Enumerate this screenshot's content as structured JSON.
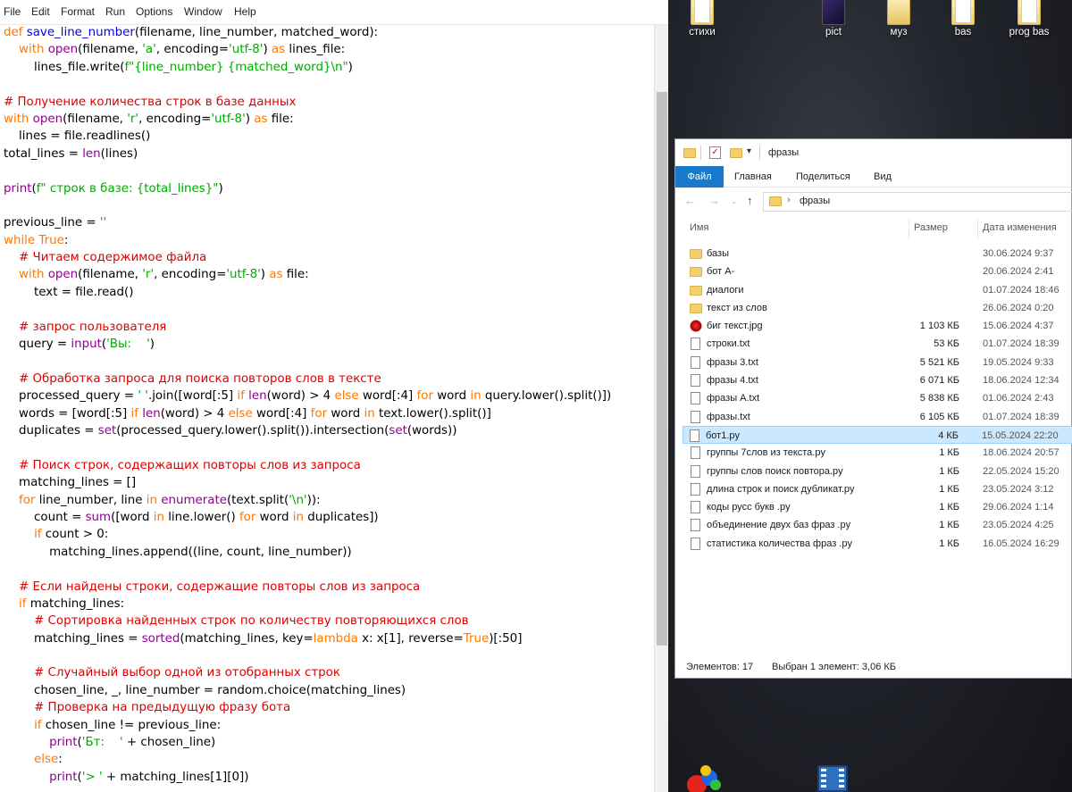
{
  "menubar": [
    "File",
    "Edit",
    "Format",
    "Run",
    "Options",
    "Window",
    "Help"
  ],
  "code_lines": [
    [
      [
        "def ",
        "kw"
      ],
      [
        "save_line_number",
        "fn"
      ],
      [
        "(filename, line_number, matched_word):",
        ""
      ]
    ],
    [
      [
        "    ",
        ""
      ],
      [
        "with ",
        "kw"
      ],
      [
        "open",
        "bi"
      ],
      [
        "(filename, ",
        ""
      ],
      [
        "'a'",
        "str"
      ],
      [
        ", encoding=",
        ""
      ],
      [
        "'utf-8'",
        "str"
      ],
      [
        ") ",
        ""
      ],
      [
        "as ",
        "kw"
      ],
      [
        "lines_file:",
        ""
      ]
    ],
    [
      [
        "        lines_file.write(",
        ""
      ],
      [
        "f\"{line_number} {matched_word}\\n\"",
        "str"
      ],
      [
        ")",
        ""
      ]
    ],
    [],
    [
      [
        "# Получение количества строк в базе данных",
        "cmt"
      ]
    ],
    [
      [
        "with ",
        "kw"
      ],
      [
        "open",
        "bi"
      ],
      [
        "(filename, ",
        ""
      ],
      [
        "'r'",
        "str"
      ],
      [
        ", encoding=",
        ""
      ],
      [
        "'utf-8'",
        "str"
      ],
      [
        ") ",
        ""
      ],
      [
        "as ",
        "kw"
      ],
      [
        "file:",
        ""
      ]
    ],
    [
      [
        "    lines = file.readlines()",
        ""
      ]
    ],
    [
      [
        "total_lines = ",
        ""
      ],
      [
        "len",
        "bi"
      ],
      [
        "(lines)",
        ""
      ]
    ],
    [],
    [
      [
        "print",
        "bi"
      ],
      [
        "(",
        ""
      ],
      [
        "f\" строк в базе: {total_lines}\"",
        "str"
      ],
      [
        ")",
        ""
      ]
    ],
    [],
    [
      [
        "previous_line = ",
        ""
      ],
      [
        "''",
        "str"
      ]
    ],
    [
      [
        "while ",
        "kw"
      ],
      [
        "True",
        "kw"
      ],
      [
        ":",
        ""
      ]
    ],
    [
      [
        "    ",
        ""
      ],
      [
        "# Читаем содержимое файла",
        "cmt"
      ]
    ],
    [
      [
        "    ",
        ""
      ],
      [
        "with ",
        "kw"
      ],
      [
        "open",
        "bi"
      ],
      [
        "(filename, ",
        ""
      ],
      [
        "'r'",
        "str"
      ],
      [
        ", encoding=",
        ""
      ],
      [
        "'utf-8'",
        "str"
      ],
      [
        ") ",
        ""
      ],
      [
        "as ",
        "kw"
      ],
      [
        "file:",
        ""
      ]
    ],
    [
      [
        "        text = file.read()",
        ""
      ]
    ],
    [],
    [
      [
        "    ",
        ""
      ],
      [
        "# запрос пользователя",
        "cmt"
      ]
    ],
    [
      [
        "    query = ",
        ""
      ],
      [
        "input",
        "bi"
      ],
      [
        "(",
        ""
      ],
      [
        "'Вы:    '",
        "str"
      ],
      [
        ")",
        ""
      ]
    ],
    [],
    [
      [
        "    ",
        ""
      ],
      [
        "# Обработка запроса для поиска повторов слов в тексте",
        "cmt"
      ]
    ],
    [
      [
        "    processed_query = ",
        ""
      ],
      [
        "' '",
        "str"
      ],
      [
        ".join([word[:5] ",
        ""
      ],
      [
        "if ",
        "kw"
      ],
      [
        "len",
        "bi"
      ],
      [
        "(word) > 4 ",
        ""
      ],
      [
        "else ",
        "kw"
      ],
      [
        "word[:4] ",
        ""
      ],
      [
        "for ",
        "kw"
      ],
      [
        "word ",
        ""
      ],
      [
        "in ",
        "kw"
      ],
      [
        "query.lower().split()])",
        ""
      ]
    ],
    [
      [
        "    words = [word[:5] ",
        ""
      ],
      [
        "if ",
        "kw"
      ],
      [
        "len",
        "bi"
      ],
      [
        "(word) > 4 ",
        ""
      ],
      [
        "else ",
        "kw"
      ],
      [
        "word[:4] ",
        ""
      ],
      [
        "for ",
        "kw"
      ],
      [
        "word ",
        ""
      ],
      [
        "in ",
        "kw"
      ],
      [
        "text.lower().split()]",
        ""
      ]
    ],
    [
      [
        "    duplicates = ",
        ""
      ],
      [
        "set",
        "bi"
      ],
      [
        "(processed_query.lower().split()).intersection(",
        ""
      ],
      [
        "set",
        "bi"
      ],
      [
        "(words))",
        ""
      ]
    ],
    [],
    [
      [
        "    ",
        ""
      ],
      [
        "# Поиск строк, содержащих повторы слов из запроса",
        "cmt"
      ]
    ],
    [
      [
        "    matching_lines = []",
        ""
      ]
    ],
    [
      [
        "    ",
        ""
      ],
      [
        "for ",
        "kw"
      ],
      [
        "line_number, line ",
        ""
      ],
      [
        "in ",
        "kw"
      ],
      [
        "enumerate",
        "bi"
      ],
      [
        "(text.split(",
        ""
      ],
      [
        "'\\n'",
        "str"
      ],
      [
        ")):",
        ""
      ]
    ],
    [
      [
        "        count = ",
        ""
      ],
      [
        "sum",
        "bi"
      ],
      [
        "([word ",
        ""
      ],
      [
        "in ",
        "kw"
      ],
      [
        "line.lower() ",
        ""
      ],
      [
        "for ",
        "kw"
      ],
      [
        "word ",
        ""
      ],
      [
        "in ",
        "kw"
      ],
      [
        "duplicates])",
        ""
      ]
    ],
    [
      [
        "        ",
        ""
      ],
      [
        "if ",
        "kw"
      ],
      [
        "count > 0:",
        ""
      ]
    ],
    [
      [
        "            matching_lines.append((line, count, line_number))",
        ""
      ]
    ],
    [],
    [
      [
        "    ",
        ""
      ],
      [
        "# Если найдены строки, содержащие повторы слов из запроса",
        "cmt"
      ]
    ],
    [
      [
        "    ",
        ""
      ],
      [
        "if ",
        "kw"
      ],
      [
        "matching_lines:",
        ""
      ]
    ],
    [
      [
        "        ",
        ""
      ],
      [
        "# Сортировка найденных строк по количеству повторяющихся слов",
        "cmt"
      ]
    ],
    [
      [
        "        matching_lines = ",
        ""
      ],
      [
        "sorted",
        "bi"
      ],
      [
        "(matching_lines, key=",
        ""
      ],
      [
        "lambda ",
        "kw"
      ],
      [
        "x: x[1], reverse=",
        ""
      ],
      [
        "True",
        "kw"
      ],
      [
        ")[:50]",
        ""
      ]
    ],
    [],
    [
      [
        "        ",
        ""
      ],
      [
        "# Случайный выбор одной из отобранных строк",
        "cmt"
      ]
    ],
    [
      [
        "        chosen_line, _, line_number = random.choice(matching_lines)",
        ""
      ]
    ],
    [
      [
        "        ",
        ""
      ],
      [
        "# Проверка на предыдущую фразу бота",
        "cmt"
      ]
    ],
    [
      [
        "        ",
        ""
      ],
      [
        "if ",
        "kw"
      ],
      [
        "chosen_line != previous_line:",
        ""
      ]
    ],
    [
      [
        "            ",
        ""
      ],
      [
        "print",
        "bi"
      ],
      [
        "(",
        ""
      ],
      [
        "'Бт:    '",
        "str"
      ],
      [
        " + chosen_line)",
        ""
      ]
    ],
    [
      [
        "        ",
        ""
      ],
      [
        "else",
        "kw"
      ],
      [
        ":",
        ""
      ]
    ],
    [
      [
        "            ",
        ""
      ],
      [
        "print",
        "bi"
      ],
      [
        "(",
        ""
      ],
      [
        "'> '",
        "str"
      ],
      [
        " + matching_lines[1][0])",
        ""
      ]
    ]
  ],
  "desktop_icons": [
    {
      "label": "стихи",
      "kind": "folder"
    },
    {
      "label": "pict",
      "kind": "thumb-dark"
    },
    {
      "label": "муз",
      "kind": "thumb-music"
    },
    {
      "label": "bas",
      "kind": "folder"
    },
    {
      "label": "prog bas",
      "kind": "folder"
    }
  ],
  "explorer": {
    "title": "фразы",
    "ribbon_tabs": [
      "Файл",
      "Главная",
      "Поделиться",
      "Вид"
    ],
    "address_path": "фразы",
    "columns": {
      "name": "Имя",
      "size": "Размер",
      "date": "Дата изменения"
    },
    "files": [
      {
        "name": "базы",
        "size": "",
        "date": "30.06.2024 9:37",
        "icon": "folder"
      },
      {
        "name": "бот А-",
        "size": "",
        "date": "20.06.2024 2:41",
        "icon": "folder"
      },
      {
        "name": "диалоги",
        "size": "",
        "date": "01.07.2024 18:46",
        "icon": "folder"
      },
      {
        "name": "текст из слов",
        "size": "",
        "date": "26.06.2024 0:20",
        "icon": "folder"
      },
      {
        "name": "биг текст.jpg",
        "size": "1 103 КБ",
        "date": "15.06.2024 4:37",
        "icon": "img"
      },
      {
        "name": "строки.txt",
        "size": "53 КБ",
        "date": "01.07.2024 18:39",
        "icon": "doc"
      },
      {
        "name": "фразы 3.txt",
        "size": "5 521 КБ",
        "date": "19.05.2024 9:33",
        "icon": "doc"
      },
      {
        "name": "фразы 4.txt",
        "size": "6 071 КБ",
        "date": "18.06.2024 12:34",
        "icon": "doc"
      },
      {
        "name": "фразы А.txt",
        "size": "5 838 КБ",
        "date": "01.06.2024 2:43",
        "icon": "doc"
      },
      {
        "name": "фразы.txt",
        "size": "6 105 КБ",
        "date": "01.07.2024 18:39",
        "icon": "doc"
      },
      {
        "name": "бот1.py",
        "size": "4 КБ",
        "date": "15.05.2024 22:20",
        "icon": "py",
        "selected": true
      },
      {
        "name": "группы 7слов из текста.py",
        "size": "1 КБ",
        "date": "18.06.2024 20:57",
        "icon": "py"
      },
      {
        "name": "группы слов  поиск повтора.py",
        "size": "1 КБ",
        "date": "22.05.2024 15:20",
        "icon": "py"
      },
      {
        "name": "длина строк и поиск дубликат.py",
        "size": "1 КБ",
        "date": "23.05.2024 3:12",
        "icon": "py"
      },
      {
        "name": "коды русс букв .py",
        "size": "1 КБ",
        "date": "29.06.2024 1:14",
        "icon": "py"
      },
      {
        "name": "объединение двух баз фраз .py",
        "size": "1 КБ",
        "date": "23.05.2024 4:25",
        "icon": "py"
      },
      {
        "name": "статистика количества фраз .py",
        "size": "1 КБ",
        "date": "16.05.2024 16:29",
        "icon": "py"
      }
    ],
    "status_items": "Элементов: 17",
    "status_selected": "Выбран 1 элемент: 3,06 КБ"
  }
}
